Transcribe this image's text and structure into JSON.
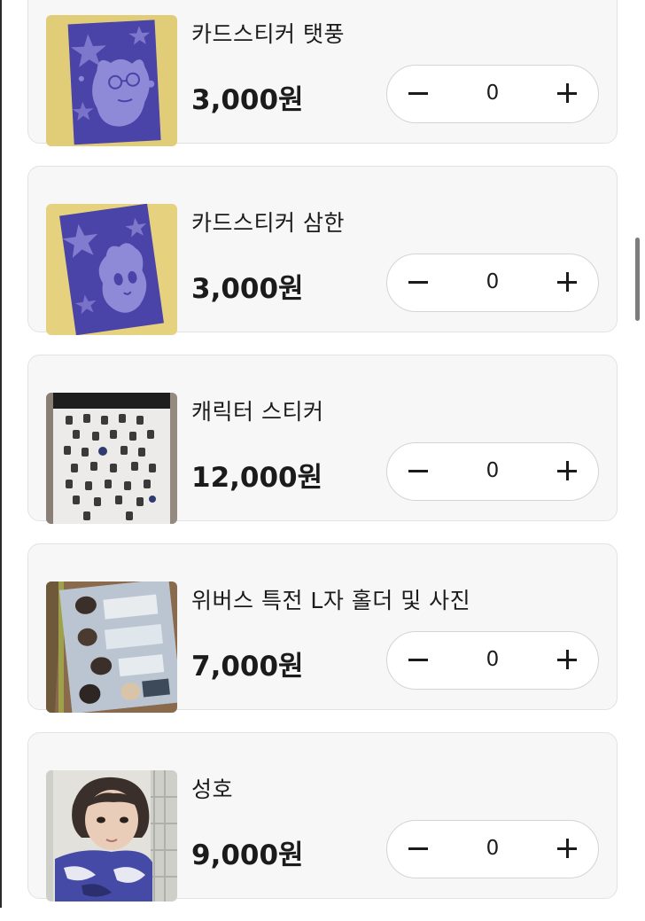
{
  "products": [
    {
      "name": "카드스티커 탯풍",
      "price": "3,000원",
      "quantity": "0",
      "image": "card-sticker-cat-photo"
    },
    {
      "name": "카드스티커 삼한",
      "price": "3,000원",
      "quantity": "0",
      "image": "card-sticker-character-photo"
    },
    {
      "name": "캐릭터 스티커",
      "price": "12,000원",
      "quantity": "0",
      "image": "character-sticker-sheet-photo"
    },
    {
      "name": "위버스 특전 L자 홀더 및 사진",
      "price": "7,000원",
      "quantity": "0",
      "image": "l-holder-photo"
    },
    {
      "name": "성호",
      "price": "9,000원",
      "quantity": "0",
      "image": "photocard-photo"
    }
  ],
  "stepper": {
    "minus_icon": "minus-icon",
    "plus_icon": "plus-icon"
  },
  "colors": {
    "card_bg": "#f7f7f7",
    "card_border": "#e2e2e2",
    "text": "#1b1b1b",
    "stepper_bg": "#ffffff",
    "sticker_blue": "#4a44a8",
    "backdrop_yellow": "#e6d27e"
  }
}
